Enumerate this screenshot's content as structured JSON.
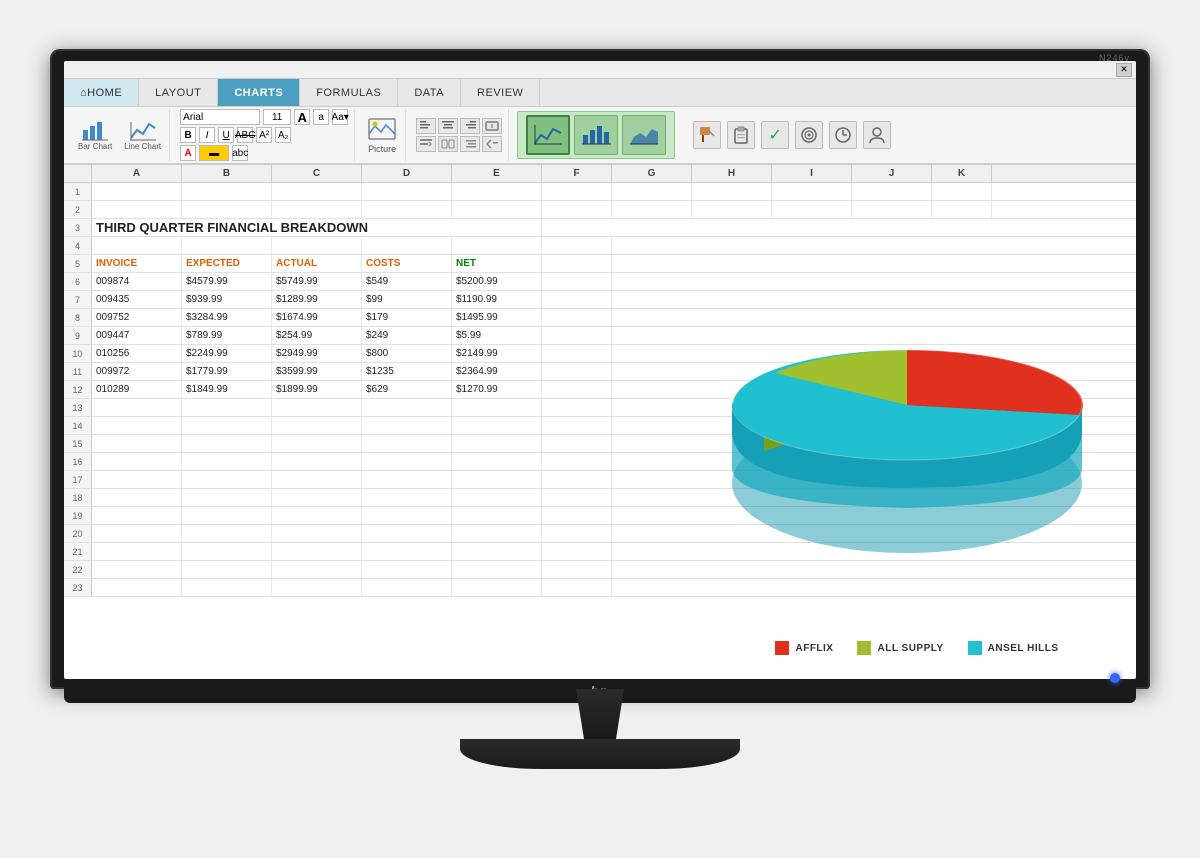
{
  "monitor": {
    "model": "N246v",
    "brand": "hp"
  },
  "titlebar": {
    "close_btn": "✕"
  },
  "menu": {
    "tabs": [
      {
        "label": "HOME",
        "id": "home",
        "active": false
      },
      {
        "label": "LAYOUT",
        "id": "layout",
        "active": false
      },
      {
        "label": "CHARTS",
        "id": "charts",
        "active": true
      },
      {
        "label": "FORMULAS",
        "id": "formulas",
        "active": false
      },
      {
        "label": "DATA",
        "id": "data",
        "active": false
      },
      {
        "label": "REVIEW",
        "id": "review",
        "active": false
      }
    ]
  },
  "toolbar": {
    "font_name": "Arial",
    "font_size": "11",
    "chart_tools": [
      {
        "label": "Bar Chart"
      },
      {
        "label": "Line Chart"
      }
    ],
    "picture_label": "Picture",
    "format_labels": [
      "A",
      "a",
      "Aa▾"
    ],
    "format2_labels": [
      "A²",
      "A₂"
    ],
    "format3_label": "abc"
  },
  "spreadsheet": {
    "title": "THIRD QUARTER FINANCIAL BREAKDOWN",
    "columns": [
      "A",
      "B",
      "C",
      "D",
      "E",
      "F",
      "G",
      "H",
      "I",
      "J",
      "K"
    ],
    "col_headers": [
      "INVOICE",
      "EXPECTED",
      "ACTUAL",
      "COSTS",
      "NET"
    ],
    "rows": [
      {
        "num": 1,
        "cells": []
      },
      {
        "num": 2,
        "cells": []
      },
      {
        "num": 3,
        "cells": [
          "THIRD QUARTER FINANCIAL BREAKDOWN"
        ]
      },
      {
        "num": 4,
        "cells": []
      },
      {
        "num": 5,
        "cells": [
          "INVOICE",
          "EXPECTED",
          "ACTUAL",
          "COSTS",
          "NET"
        ],
        "type": "header"
      },
      {
        "num": 6,
        "cells": [
          "009874",
          "$4579.99",
          "$5749.99",
          "$549",
          "$5200.99"
        ]
      },
      {
        "num": 7,
        "cells": [
          "009435",
          "$939.99",
          "$1289.99",
          "$99",
          "$1190.99"
        ]
      },
      {
        "num": 8,
        "cells": [
          "009752",
          "$3284.99",
          "$1674.99",
          "$179",
          "$1495.99"
        ]
      },
      {
        "num": 9,
        "cells": [
          "009447",
          "$789.99",
          "$254.99",
          "$249",
          "$5.99"
        ]
      },
      {
        "num": 10,
        "cells": [
          "010256",
          "$2249.99",
          "$2949.99",
          "$800",
          "$2149.99"
        ]
      },
      {
        "num": 11,
        "cells": [
          "009972",
          "$1779.99",
          "$3599.99",
          "$1235",
          "$2364.99"
        ]
      },
      {
        "num": 12,
        "cells": [
          "010289",
          "$1849.99",
          "$1899.99",
          "$629",
          "$1270.99"
        ]
      },
      {
        "num": 13,
        "cells": []
      },
      {
        "num": 14,
        "cells": []
      },
      {
        "num": 15,
        "cells": []
      },
      {
        "num": 16,
        "cells": []
      },
      {
        "num": 17,
        "cells": []
      },
      {
        "num": 18,
        "cells": []
      },
      {
        "num": 19,
        "cells": []
      },
      {
        "num": 20,
        "cells": []
      },
      {
        "num": 21,
        "cells": []
      },
      {
        "num": 22,
        "cells": []
      },
      {
        "num": 23,
        "cells": []
      }
    ]
  },
  "chart": {
    "type": "pie3d",
    "segments": [
      {
        "label": "AFFLIX",
        "color": "#e03020",
        "pct": 15
      },
      {
        "label": "ALL SUPPLY",
        "color": "#a0c030",
        "pct": 25
      },
      {
        "label": "ANSEL HILLS",
        "color": "#20c0d0",
        "pct": 60
      }
    ]
  }
}
